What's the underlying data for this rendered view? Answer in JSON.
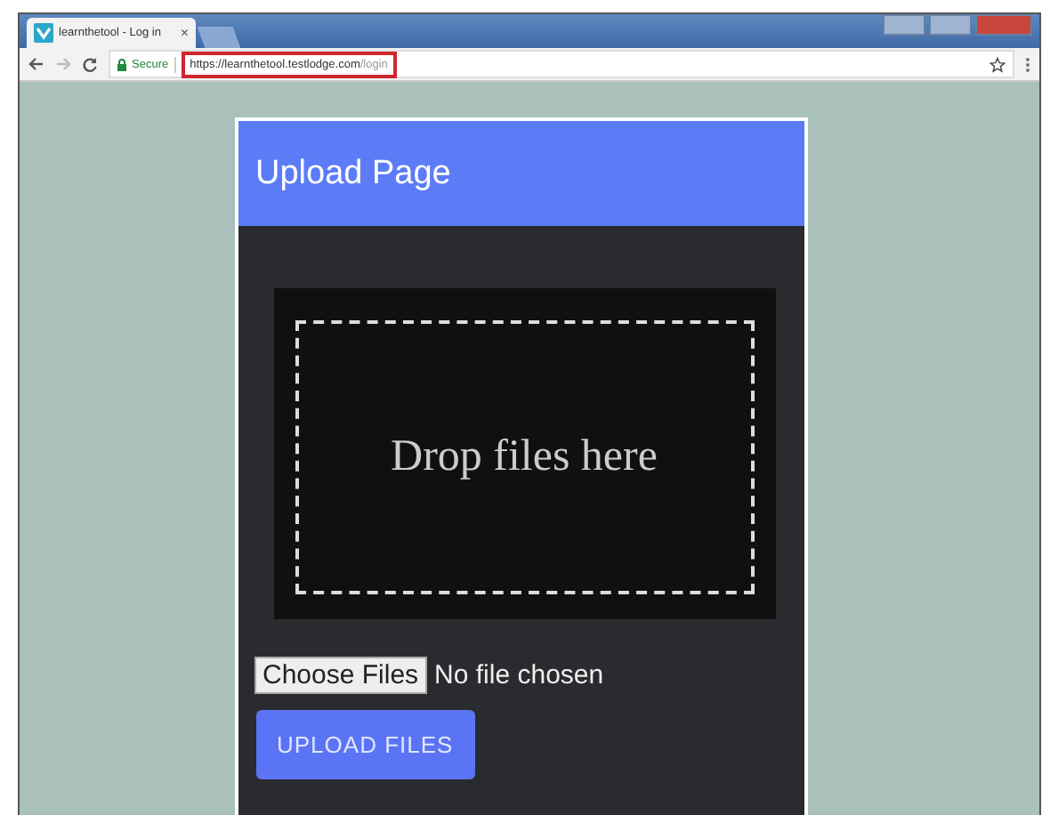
{
  "browser": {
    "tab": {
      "title": "learnthetool - Log in",
      "close": "×"
    },
    "secure_label": "Secure",
    "url_host": "https://learnthetool.testlodge.com",
    "url_path": "/login",
    "url_highlighted": true
  },
  "card": {
    "title": "Upload Page",
    "dropzone_text": "Drop files here",
    "file_button": "Choose Files",
    "file_status": "No file chosen",
    "upload_button": "UPLOAD FILES"
  }
}
